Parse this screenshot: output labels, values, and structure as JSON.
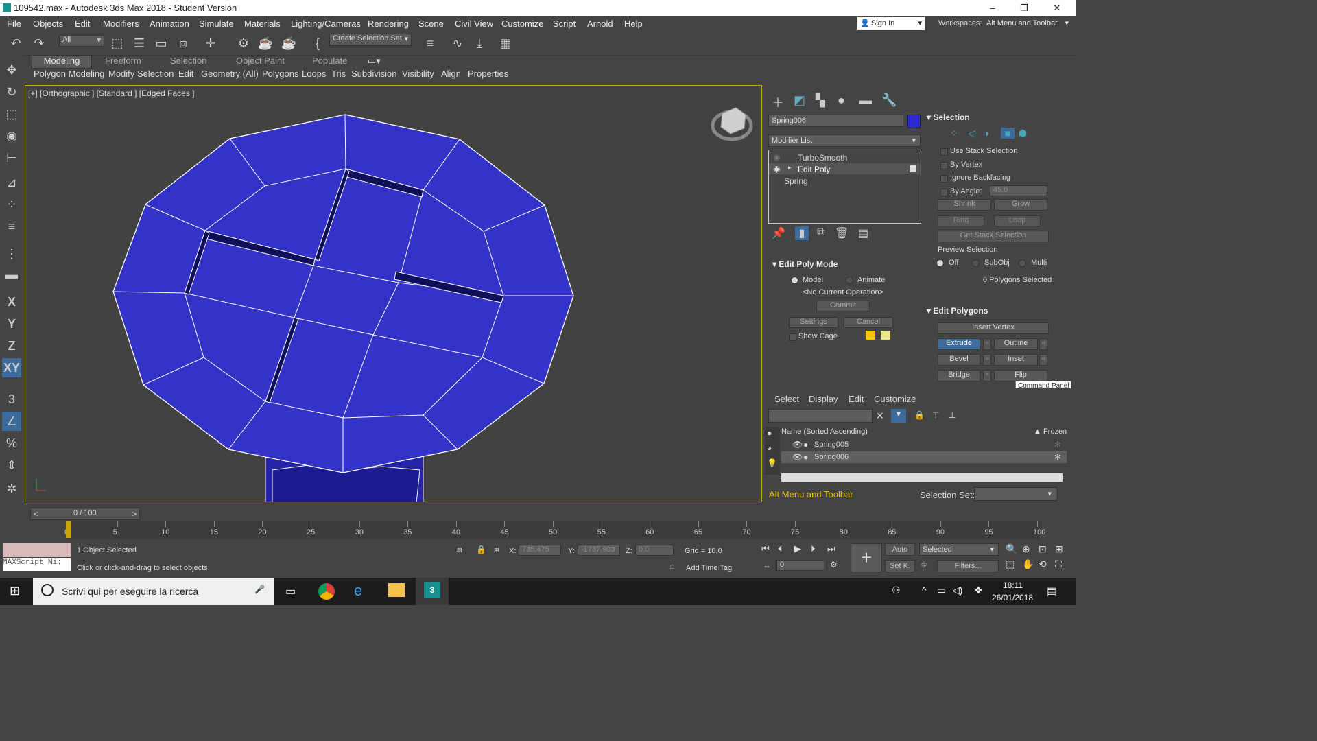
{
  "titlebar": {
    "title": "109542.max - Autodesk 3ds Max 2018 - Student Version",
    "minimize": "–",
    "restore": "❐",
    "close": "✕"
  },
  "menubar": {
    "items": [
      "File",
      "Objects",
      "Edit",
      "Modifiers",
      "Animation",
      "Simulate",
      "Materials",
      "Lighting/Cameras",
      "Rendering",
      "Scene",
      "Civil View",
      "Customize",
      "Script",
      "Arnold",
      "Help"
    ],
    "signin": "Sign In",
    "workspaces_label": "Workspaces:",
    "workspaces_value": "Alt Menu and Toolbar"
  },
  "toolbar": {
    "filter": "All",
    "selection_set": "Create Selection Set"
  },
  "ribbon": {
    "tabs": [
      "Modeling",
      "Freeform",
      "Selection",
      "Object Paint",
      "Populate"
    ],
    "items": [
      "Polygon Modeling",
      "Modify Selection",
      "Edit",
      "Geometry (All)",
      "Polygons",
      "Loops",
      "Tris",
      "Subdivision",
      "Visibility",
      "Align",
      "Properties"
    ]
  },
  "viewport": {
    "label": "[+] [Orthographic ] [Standard ] [Edged Faces ]",
    "object_color": "#3333c8"
  },
  "command_panel": {
    "object_name": "Spring006",
    "object_color": "#2a2ad0",
    "modifier_list": "Modifier List",
    "stack": [
      "TurboSmooth",
      "Edit Poly",
      "Spring"
    ],
    "edit_poly_mode": {
      "title": "Edit Poly Mode",
      "model": "Model",
      "animate": "Animate",
      "no_op": "<No Current Operation>",
      "commit": "Commit",
      "settings": "Settings",
      "cancel": "Cancel",
      "show_cage": "Show Cage"
    },
    "selection": {
      "title": "Selection",
      "use_stack": "Use Stack Selection",
      "by_vertex": "By Vertex",
      "ignore_backfacing": "Ignore Backfacing",
      "by_angle": "By Angle:",
      "angle_value": "45,0",
      "shrink": "Shrink",
      "grow": "Grow",
      "ring": "Ring",
      "loop": "Loop",
      "get_stack": "Get Stack Selection",
      "preview": "Preview Selection",
      "off": "Off",
      "subobj": "SubObj",
      "multi": "Multi",
      "count": "0 Polygons Selected"
    },
    "edit_polygons": {
      "title": "Edit Polygons",
      "insert_vertex": "Insert Vertex",
      "extrude": "Extrude",
      "outline": "Outline",
      "bevel": "Bevel",
      "inset": "Inset",
      "bridge": "Bridge",
      "flip": "Flip"
    },
    "tooltip": "Command Panel"
  },
  "scene_explorer": {
    "tabs": [
      "Select",
      "Display",
      "Edit",
      "Customize"
    ],
    "col_name": "Name (Sorted Ascending)",
    "col_frozen": "▲ Frozen",
    "rows": [
      "Spring005",
      "Spring006"
    ],
    "workspace": "Alt Menu and Toolbar",
    "selection_set_label": "Selection Set:"
  },
  "timeline": {
    "frame": "0 / 100",
    "ticks": [
      "0",
      "5",
      "10",
      "15",
      "20",
      "25",
      "30",
      "35",
      "40",
      "45",
      "50",
      "55",
      "60",
      "65",
      "70",
      "75",
      "80",
      "85",
      "90",
      "95",
      "100"
    ]
  },
  "status": {
    "maxscript": "MAXScript Mi:",
    "selected": "1 Object Selected",
    "prompt": "Click or click-and-drag to select objects",
    "x_label": "X:",
    "x": "735,475",
    "y_label": "Y:",
    "y": "-1737,903",
    "z_label": "Z:",
    "z": "0,0",
    "grid": "Grid = 10,0",
    "add_time_tag": "Add Time Tag",
    "auto": "Auto",
    "selected_dd": "Selected",
    "setk": "Set K.",
    "filters": "Filters...",
    "frame_field": "0"
  },
  "taskbar": {
    "search": "Scrivi qui per eseguire la ricerca",
    "time": "18:11",
    "date": "26/01/2018"
  }
}
